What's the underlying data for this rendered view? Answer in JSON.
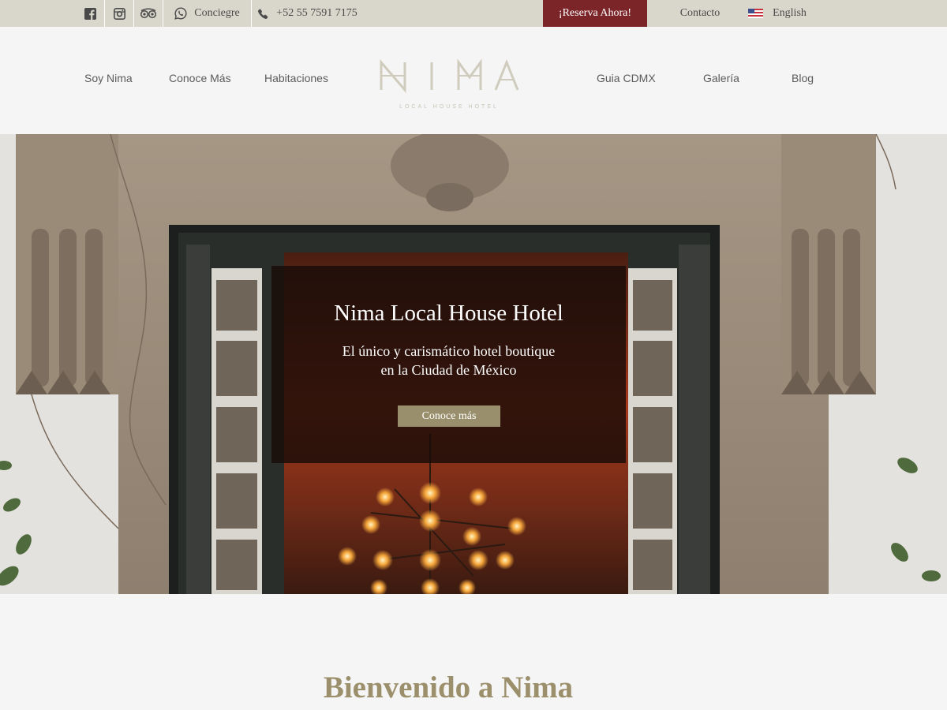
{
  "topbar": {
    "social": [
      {
        "icon": "facebook-icon"
      },
      {
        "icon": "instagram-icon"
      },
      {
        "icon": "tripadvisor-icon"
      }
    ],
    "concierge": {
      "icon": "whatsapp-icon",
      "label": "Conciegre"
    },
    "phone": {
      "icon": "phone-icon",
      "label": "+52 55 7591 7175"
    },
    "reserve_label": "¡Reserva Ahora!",
    "contact_label": "Contacto",
    "language": {
      "icon": "us-flag-icon",
      "label": "English"
    },
    "colors": {
      "bar": "#d9d7cb",
      "reserve": "#7b2529"
    }
  },
  "nav": {
    "left": [
      {
        "label": "Soy Nima"
      },
      {
        "label": "Conoce Más"
      },
      {
        "label": "Habitaciones"
      }
    ],
    "right": [
      {
        "label": "Guia CDMX"
      },
      {
        "label": "Galería"
      },
      {
        "label": "Blog"
      }
    ]
  },
  "logo": {
    "name": "NIMA",
    "tagline": "LOCAL HOUSE HOTEL"
  },
  "hero": {
    "title": "Nima Local House Hotel",
    "subtitle_line1": "El único y carismático hotel boutique",
    "subtitle_line2": "en la Ciudad de México",
    "button_label": "Conoce más",
    "button_color": "#9a8f6d"
  },
  "welcome": {
    "title": "Bienvenido a Nima",
    "title_color": "#9c8f6b"
  }
}
